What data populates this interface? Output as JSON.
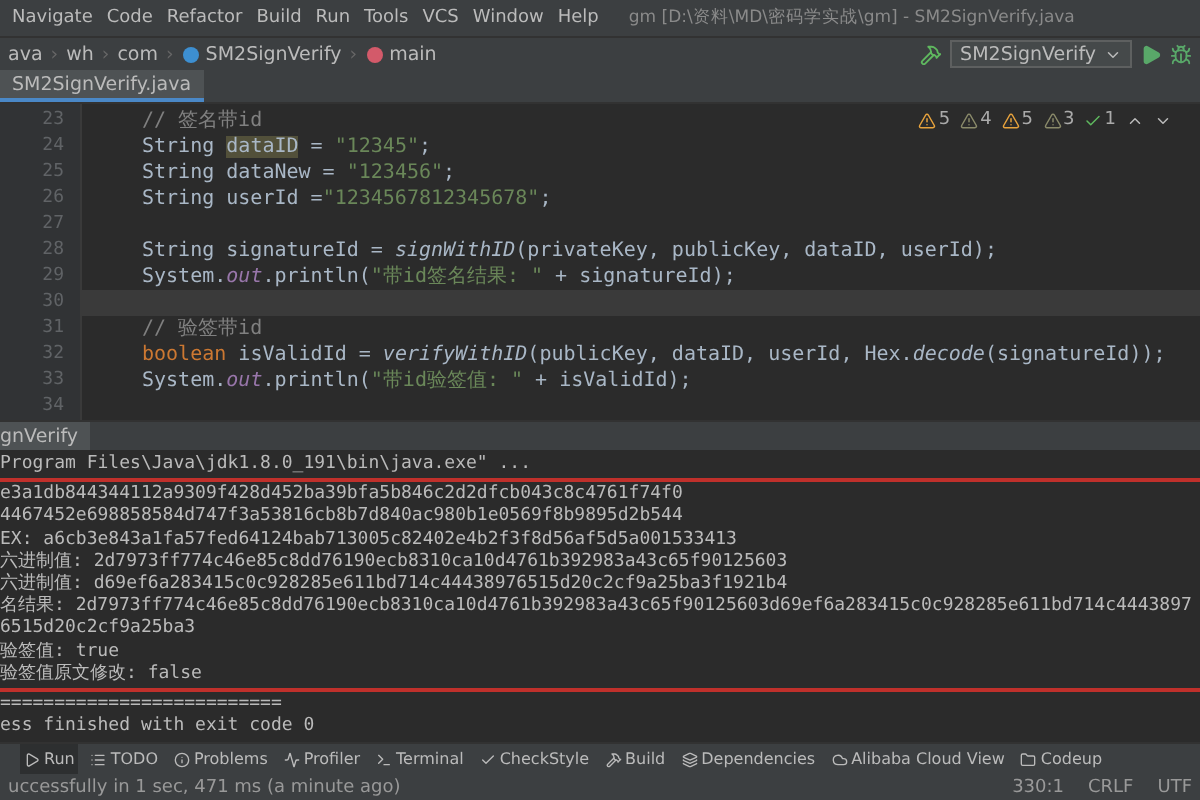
{
  "menu": {
    "items": [
      "Navigate",
      "Code",
      "Refactor",
      "Build",
      "Run",
      "Tools",
      "VCS",
      "Window",
      "Help"
    ],
    "title": "gm [D:\\资料\\MD\\密码学实战\\gm] - SM2SignVerify.java"
  },
  "navbar": {
    "crumbs": [
      {
        "label": "ava",
        "kind": "folder"
      },
      {
        "label": "wh",
        "kind": "folder"
      },
      {
        "label": "com",
        "kind": "folder"
      },
      {
        "label": "SM2SignVerify",
        "kind": "class"
      },
      {
        "label": "main",
        "kind": "method"
      }
    ],
    "run_config": "SM2SignVerify",
    "separator": "›"
  },
  "editor_tabs": [
    {
      "label": "SM2SignVerify.java",
      "selected": true
    }
  ],
  "inspections": [
    {
      "kind": "warning",
      "count": "5"
    },
    {
      "kind": "weak",
      "count": "4"
    },
    {
      "kind": "warning",
      "count": "5"
    },
    {
      "kind": "weak",
      "count": "3"
    },
    {
      "kind": "ok",
      "count": "1"
    }
  ],
  "code": [
    {
      "number": "23",
      "tokens": [
        {
          "kind": "comment",
          "text": "// 签名带id"
        }
      ]
    },
    {
      "number": "24",
      "tokens": [
        {
          "kind": "plain",
          "text": "String "
        },
        {
          "kind": "highlight",
          "text": "dataID"
        },
        {
          "kind": "plain",
          "text": " = "
        },
        {
          "kind": "string",
          "text": "\"12345\""
        },
        {
          "kind": "plain",
          "text": ";"
        }
      ]
    },
    {
      "number": "25",
      "tokens": [
        {
          "kind": "plain",
          "text": "String dataNew = "
        },
        {
          "kind": "string",
          "text": "\"123456\""
        },
        {
          "kind": "plain",
          "text": ";"
        }
      ]
    },
    {
      "number": "26",
      "tokens": [
        {
          "kind": "plain",
          "text": "String userId ="
        },
        {
          "kind": "string",
          "text": "\"1234567812345678\""
        },
        {
          "kind": "plain",
          "text": ";"
        }
      ]
    },
    {
      "number": "27"
    },
    {
      "number": "28",
      "tokens": [
        {
          "kind": "plain",
          "text": "String signatureId = "
        },
        {
          "kind": "method",
          "text": "signWithID"
        },
        {
          "kind": "plain",
          "text": "(privateKey, publicKey, dataID, userId);"
        }
      ]
    },
    {
      "number": "29",
      "tokens": [
        {
          "kind": "plain",
          "text": "System."
        },
        {
          "kind": "static",
          "text": "out"
        },
        {
          "kind": "plain",
          "text": ".println("
        },
        {
          "kind": "string",
          "text": "\"带id签名结果: \""
        },
        {
          "kind": "plain",
          "text": " + signatureId);"
        }
      ]
    },
    {
      "number": "30",
      "current": true
    },
    {
      "number": "31",
      "tokens": [
        {
          "kind": "comment",
          "text": "// 验签带id"
        }
      ]
    },
    {
      "number": "32",
      "tokens": [
        {
          "kind": "keyword",
          "text": "boolean "
        },
        {
          "kind": "plain",
          "text": "isValidId = "
        },
        {
          "kind": "method",
          "text": "verifyWithID"
        },
        {
          "kind": "plain",
          "text": "(publicKey, dataID, userId, Hex."
        },
        {
          "kind": "method",
          "text": "decode"
        },
        {
          "kind": "plain",
          "text": "(signatureId));"
        }
      ]
    },
    {
      "number": "33",
      "tokens": [
        {
          "kind": "plain",
          "text": "System."
        },
        {
          "kind": "static",
          "text": "out"
        },
        {
          "kind": "plain",
          "text": ".println("
        },
        {
          "kind": "string",
          "text": "\"带id验签值: \""
        },
        {
          "kind": "plain",
          "text": " + isValidId);"
        }
      ]
    },
    {
      "number": "34"
    }
  ],
  "run_panel": {
    "tab": "gnVerify",
    "lines": [
      {
        "text": "Program Files\\Java\\jdk1.8.0_191\\bin\\java.exe\" ...",
        "underlined": true
      },
      {
        "text": "e3a1db844344112a9309f428d452ba39bfa5b846c2d2dfcb043c8c4761f74f0",
        "underlined": false
      },
      {
        "text": "4467452e698858584d747f3a53816cb8b7d840ac980b1e0569f8b9895d2b544",
        "underlined": false
      },
      {
        "text": "EX: a6cb3e843a1fa57fed64124bab713005c82402e4b2f3f8d56af5d5a001533413",
        "underlined": false
      },
      {
        "text": "六进制值: 2d7973ff774c46e85c8dd76190ecb8310ca10d4761b392983a43c65f90125603",
        "underlined": false
      },
      {
        "text": "六进制值: d69ef6a283415c0c928285e611bd714c44438976515d20c2cf9a25ba3f1921b4",
        "underlined": false
      },
      {
        "text": "名结果: 2d7973ff774c46e85c8dd76190ecb8310ca10d4761b392983a43c65f90125603d69ef6a283415c0c928285e611bd714c44438976515d20c2cf9a25ba3",
        "underlined": false
      },
      {
        "text": "验签值: true",
        "underlined": false
      },
      {
        "text": "验签值原文修改: false",
        "underlined": true
      },
      {
        "text": "==========================",
        "underlined": false
      },
      {
        "text": "ess finished with exit code 0",
        "underlined": false
      }
    ]
  },
  "tool_strip": [
    {
      "label": "Run",
      "selected": true
    },
    {
      "label": "TODO",
      "selected": false
    },
    {
      "label": "Problems",
      "selected": false
    },
    {
      "label": "Profiler",
      "selected": false
    },
    {
      "label": "Terminal",
      "selected": false
    },
    {
      "label": "CheckStyle",
      "selected": false
    },
    {
      "label": "Build",
      "selected": false
    },
    {
      "label": "Dependencies",
      "selected": false
    },
    {
      "label": "Alibaba Cloud View",
      "selected": false
    },
    {
      "label": "Codeup",
      "selected": false
    }
  ],
  "status_bar": {
    "message": "uccessfully in 1 sec, 471 ms (a minute ago)",
    "position": "330:1",
    "line_separator": "CRLF",
    "encoding": "UTF"
  }
}
